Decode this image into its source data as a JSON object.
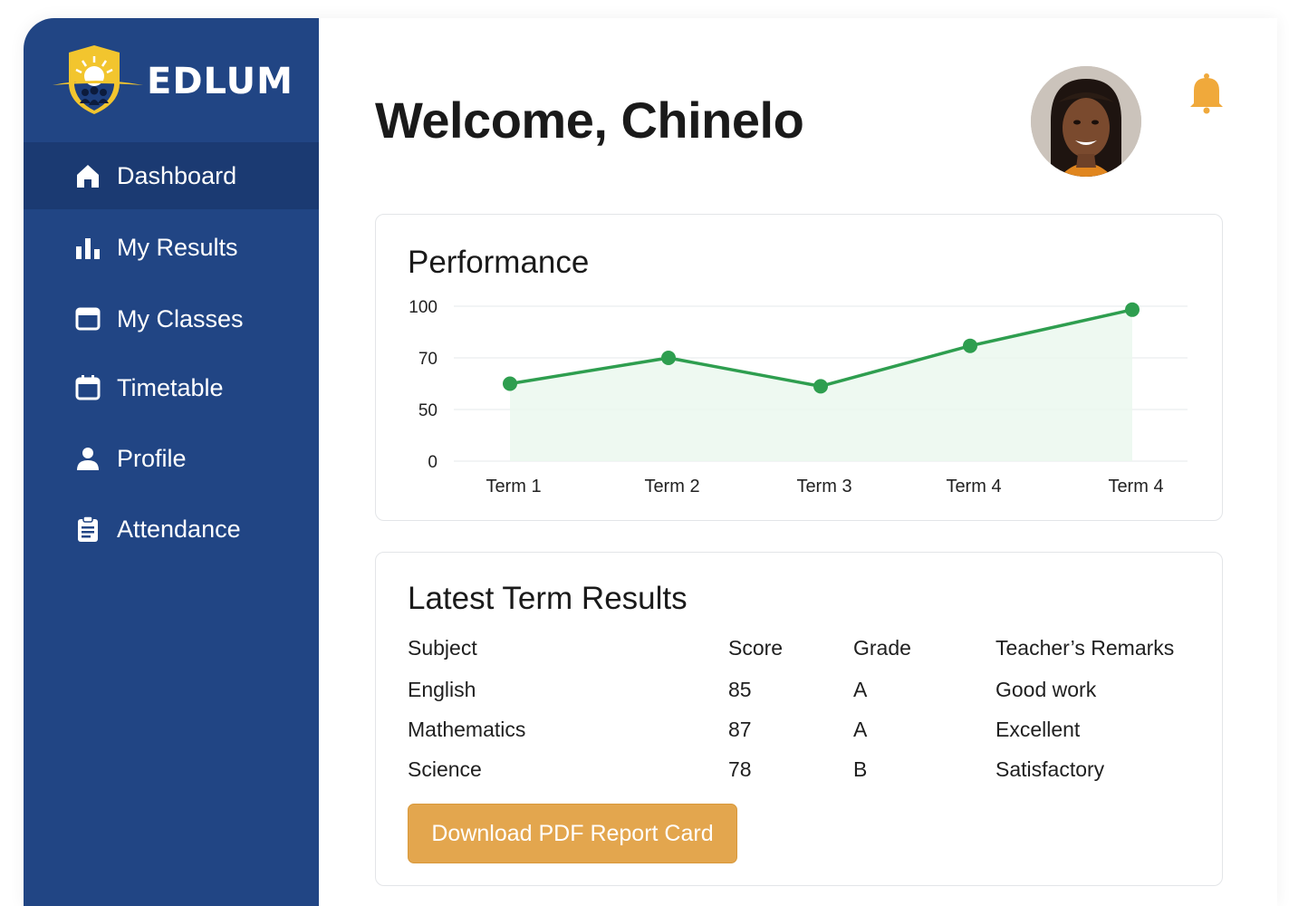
{
  "brand": {
    "name": "EDLUM"
  },
  "sidebar": {
    "items": [
      {
        "label": "Dashboard",
        "icon": "home-icon",
        "active": true
      },
      {
        "label": "My Results",
        "icon": "bar-chart-icon",
        "active": false
      },
      {
        "label": "My Classes",
        "icon": "window-icon",
        "active": false
      },
      {
        "label": "Timetable",
        "icon": "calendar-icon",
        "active": false
      },
      {
        "label": "Profile",
        "icon": "user-icon",
        "active": false
      },
      {
        "label": "Attendance",
        "icon": "clipboard-icon",
        "active": false
      }
    ]
  },
  "header": {
    "welcome": "Welcome, Chinelo",
    "avatar": "avatar-photo",
    "notification_icon": "bell-icon"
  },
  "performance": {
    "title": "Performance"
  },
  "chart_data": {
    "type": "line",
    "title": "Performance",
    "xlabel": "",
    "ylabel": "",
    "categories": [
      "Term 1",
      "Term 2",
      "Term 3",
      "Term 4",
      "Term 4"
    ],
    "yticks": [
      "100",
      "70",
      "50",
      "0"
    ],
    "series": [
      {
        "values": [
          60,
          70,
          59,
          77,
          98
        ]
      }
    ],
    "ylim": [
      0,
      100
    ],
    "grid": true,
    "colors": {
      "line": "#2e9e4f",
      "fill": "#eaf7ee"
    }
  },
  "results": {
    "title": "Latest Term Results",
    "columns": [
      "Subject",
      "Score",
      "Grade",
      "Teacher’s Remarks"
    ],
    "rows": [
      [
        "English",
        "85",
        "A",
        "Good work"
      ],
      [
        "Mathematics",
        "87",
        "A",
        "Excellent"
      ],
      [
        "Science",
        "78",
        "B",
        "Satisfactory"
      ]
    ],
    "download_label": "Download PDF Report Card"
  },
  "colors": {
    "sidebar": "#214584",
    "sidebar_active": "#1b3a72",
    "accent": "#e3a64e",
    "bell": "#f0a93b"
  }
}
